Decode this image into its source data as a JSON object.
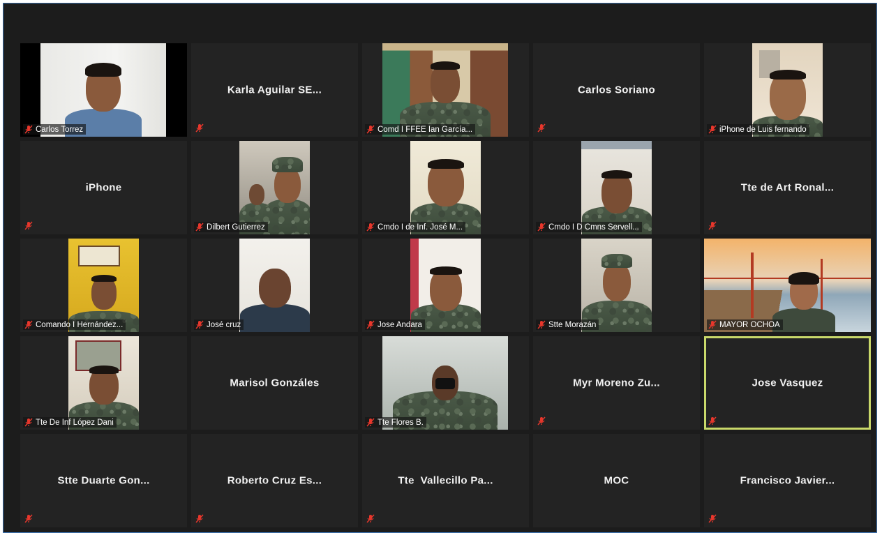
{
  "participants": [
    {
      "name": "Carlos Torrez",
      "video": true
    },
    {
      "name": "Karla Aguilar SE...",
      "video": false
    },
    {
      "name": "Comd I FFEE Ian García...",
      "video": true
    },
    {
      "name": "Carlos Soriano",
      "video": false
    },
    {
      "name": "iPhone de Luis fernando",
      "video": true
    },
    {
      "name": "iPhone",
      "video": false
    },
    {
      "name": "Dilbert Gutierrez",
      "video": true
    },
    {
      "name": "Cmdo I de Inf. José M...",
      "video": true
    },
    {
      "name": "Cmdo I D Cmns Servell...",
      "video": true
    },
    {
      "name": "Tte de Art Ronal...",
      "video": false
    },
    {
      "name": "Comando I Hernández...",
      "video": true
    },
    {
      "name": "José cruz",
      "video": true
    },
    {
      "name": "Jose Andara",
      "video": true
    },
    {
      "name": "Stte Morazán",
      "video": true
    },
    {
      "name": "MAYOR OCHOA",
      "video": true
    },
    {
      "name": "Tte De Inf López Dani",
      "video": true
    },
    {
      "name": "Marisol Gonzáles",
      "video": false
    },
    {
      "name": "Tte Flores B.",
      "video": true
    },
    {
      "name": "Myr Moreno Zu...",
      "video": false
    },
    {
      "name": "Jose Vasquez",
      "video": false,
      "active_speaker": true
    },
    {
      "name": "Stte Duarte Gon...",
      "video": false
    },
    {
      "name": "Roberto Cruz Es...",
      "video": false
    },
    {
      "name": "Tte  Vallecillo Pa...",
      "video": false
    },
    {
      "name": "MOC",
      "video": false
    },
    {
      "name": "Francisco Javier...",
      "video": false
    }
  ],
  "icons": {
    "muted_mic": "muted-microphone-icon"
  },
  "colors": {
    "background": "#1c1c1c",
    "tile": "#232323",
    "active_speaker_border": "#c9d86a",
    "muted_icon": "#e8372c"
  }
}
